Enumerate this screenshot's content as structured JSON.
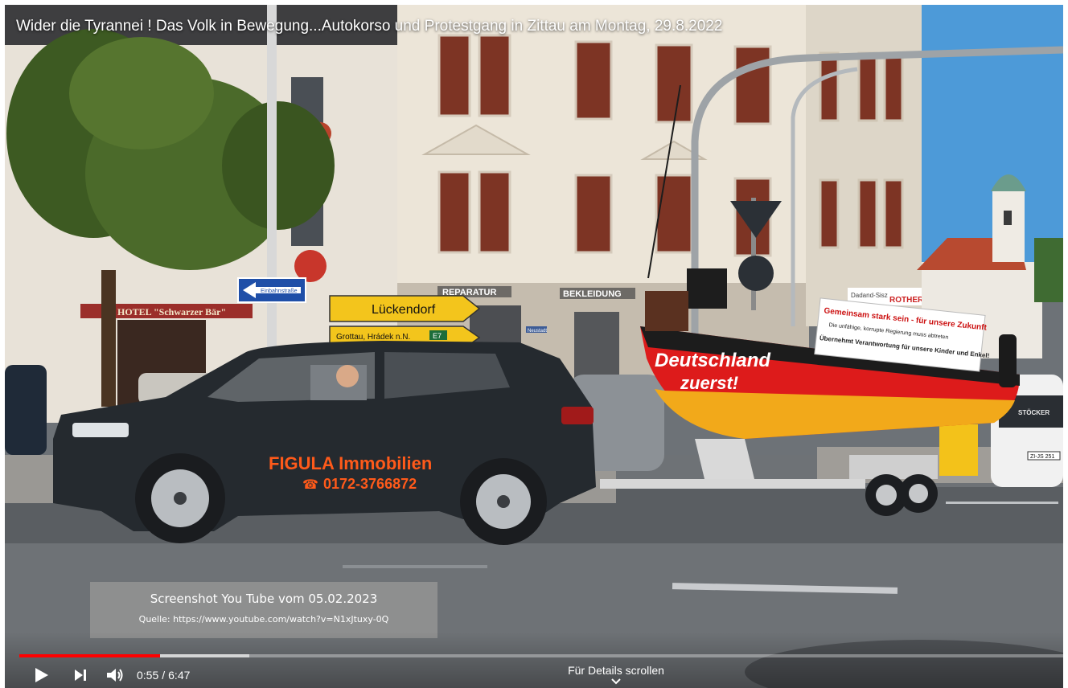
{
  "video": {
    "title": "Wider die Tyrannei ! Das Volk in Bewegung...Autokorso und Protestgang in Zittau am Montag, 29.8.2022"
  },
  "scene": {
    "street_sign_arrow": "Einbahnstraße",
    "sign_yellow_1": "Lückendorf",
    "sign_yellow_2": "Grottau, Hrádek n.N.",
    "sign_yellow_2_badge": "E7",
    "hotel_sign": "HOTEL \"Schwarzer Bär\"",
    "shop_sign_1": "REPARATUR",
    "shop_sign_2": "BEKLEIDUNG",
    "shop_sign_3": "ROTHER",
    "shop_sign_4": "Dadand-Sisz",
    "car_brand_1": "FIGULA Immobilien",
    "car_phone": "0172-3766872",
    "boat_text_1": "Deutschland",
    "boat_text_2": "zuerst!",
    "banner_line1": "Gemeinsam stark sein - für unsere Zukunft",
    "banner_line2": "Die unfähige, korrupte Regierung muss abtreten",
    "banner_line3": "Übernehmt Verantwortung für unsere Kinder und Enkel!",
    "van_text": "STÖCKER",
    "van_plate": "ZI-JS 251",
    "street_sign_small": "Neustadt"
  },
  "overlay": {
    "line1": "Screenshot You Tube vom 05.02.2023",
    "line2": "Quelle: https://www.youtube.com/watch?v=N1xJtuxy-0Q"
  },
  "player": {
    "current_time": "0:55",
    "separator": "/",
    "duration": "6:47",
    "played_fraction": 0.135,
    "buffered_fraction": 0.22,
    "details_label": "Für Details scrollen",
    "colors": {
      "progress": "#ff0000",
      "controls": "#ffffff"
    },
    "icons": [
      "play-icon",
      "next-icon",
      "volume-icon",
      "chevron-down-icon"
    ]
  }
}
